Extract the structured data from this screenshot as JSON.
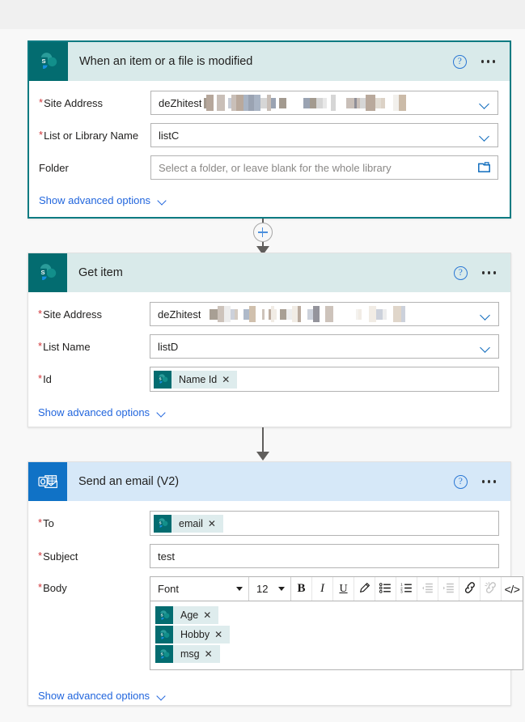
{
  "app": {
    "background": "#f8f8f8",
    "accent_sharepoint": "#036c70",
    "accent_outlook": "#1072c6",
    "link_color": "#2266dd",
    "required_color": "#d13438"
  },
  "cards": [
    {
      "id": "trigger",
      "title": "When an item or a file is modified",
      "connector": "sharepoint",
      "icon": "sharepoint-icon",
      "selected": true,
      "help_label": "?",
      "fields": [
        {
          "name": "site-address",
          "label": "Site Address",
          "required": true,
          "control": "dropdown",
          "value": "deZhitest",
          "redacted": true
        },
        {
          "name": "list-or-library-name",
          "label": "List or Library Name",
          "required": true,
          "control": "dropdown",
          "value": "listC",
          "redacted": false
        },
        {
          "name": "folder",
          "label": "Folder",
          "required": false,
          "control": "folder-picker",
          "value": "",
          "placeholder": "Select a folder, or leave blank for the whole library",
          "redacted": false
        }
      ],
      "advanced_label": "Show advanced options"
    },
    {
      "id": "get-item",
      "title": "Get item",
      "connector": "sharepoint",
      "icon": "sharepoint-icon",
      "selected": false,
      "help_label": "?",
      "fields": [
        {
          "name": "site-address",
          "label": "Site Address",
          "required": true,
          "control": "dropdown",
          "value": "deZhitest",
          "redacted": true
        },
        {
          "name": "list-name",
          "label": "List Name",
          "required": true,
          "control": "dropdown",
          "value": "listD",
          "redacted": false
        },
        {
          "name": "id",
          "label": "Id",
          "required": true,
          "control": "token",
          "tokens": [
            "Name Id"
          ],
          "redacted": false
        }
      ],
      "advanced_label": "Show advanced options"
    },
    {
      "id": "send-email",
      "title": "Send an email (V2)",
      "connector": "outlook",
      "icon": "outlook-icon",
      "selected": false,
      "help_label": "?",
      "fields": [
        {
          "name": "to",
          "label": "To",
          "required": true,
          "control": "token",
          "tokens": [
            "email"
          ],
          "redacted": false
        },
        {
          "name": "subject",
          "label": "Subject",
          "required": true,
          "control": "text",
          "value": "test",
          "redacted": false
        },
        {
          "name": "body",
          "label": "Body",
          "required": true,
          "control": "richtext",
          "tokens": [
            "Age",
            "Hobby",
            "msg"
          ]
        }
      ],
      "advanced_label": "Show advanced options"
    }
  ],
  "richtext_toolbar": {
    "font_label": "Font",
    "size_label": "12",
    "buttons": [
      {
        "name": "bold-button",
        "glyph": "B",
        "style": "b",
        "disabled": false
      },
      {
        "name": "italic-button",
        "glyph": "I",
        "style": "i",
        "disabled": false
      },
      {
        "name": "underline-button",
        "glyph": "U",
        "style": "u",
        "disabled": false
      },
      {
        "name": "font-color-button",
        "glyph": "",
        "style": "pen",
        "disabled": false
      },
      {
        "name": "bulleted-list-button",
        "glyph": "",
        "style": "ul",
        "disabled": false
      },
      {
        "name": "numbered-list-button",
        "glyph": "",
        "style": "ol",
        "disabled": false
      },
      {
        "name": "outdent-button",
        "glyph": "",
        "style": "out",
        "disabled": true
      },
      {
        "name": "indent-button",
        "glyph": "",
        "style": "in",
        "disabled": true
      },
      {
        "name": "insert-link-button",
        "glyph": "",
        "style": "link",
        "disabled": false
      },
      {
        "name": "remove-link-button",
        "glyph": "",
        "style": "unlink",
        "disabled": true
      },
      {
        "name": "code-view-button",
        "glyph": "</>",
        "style": "code",
        "disabled": false
      }
    ]
  },
  "connectors": {
    "insert_step_label": "+"
  }
}
